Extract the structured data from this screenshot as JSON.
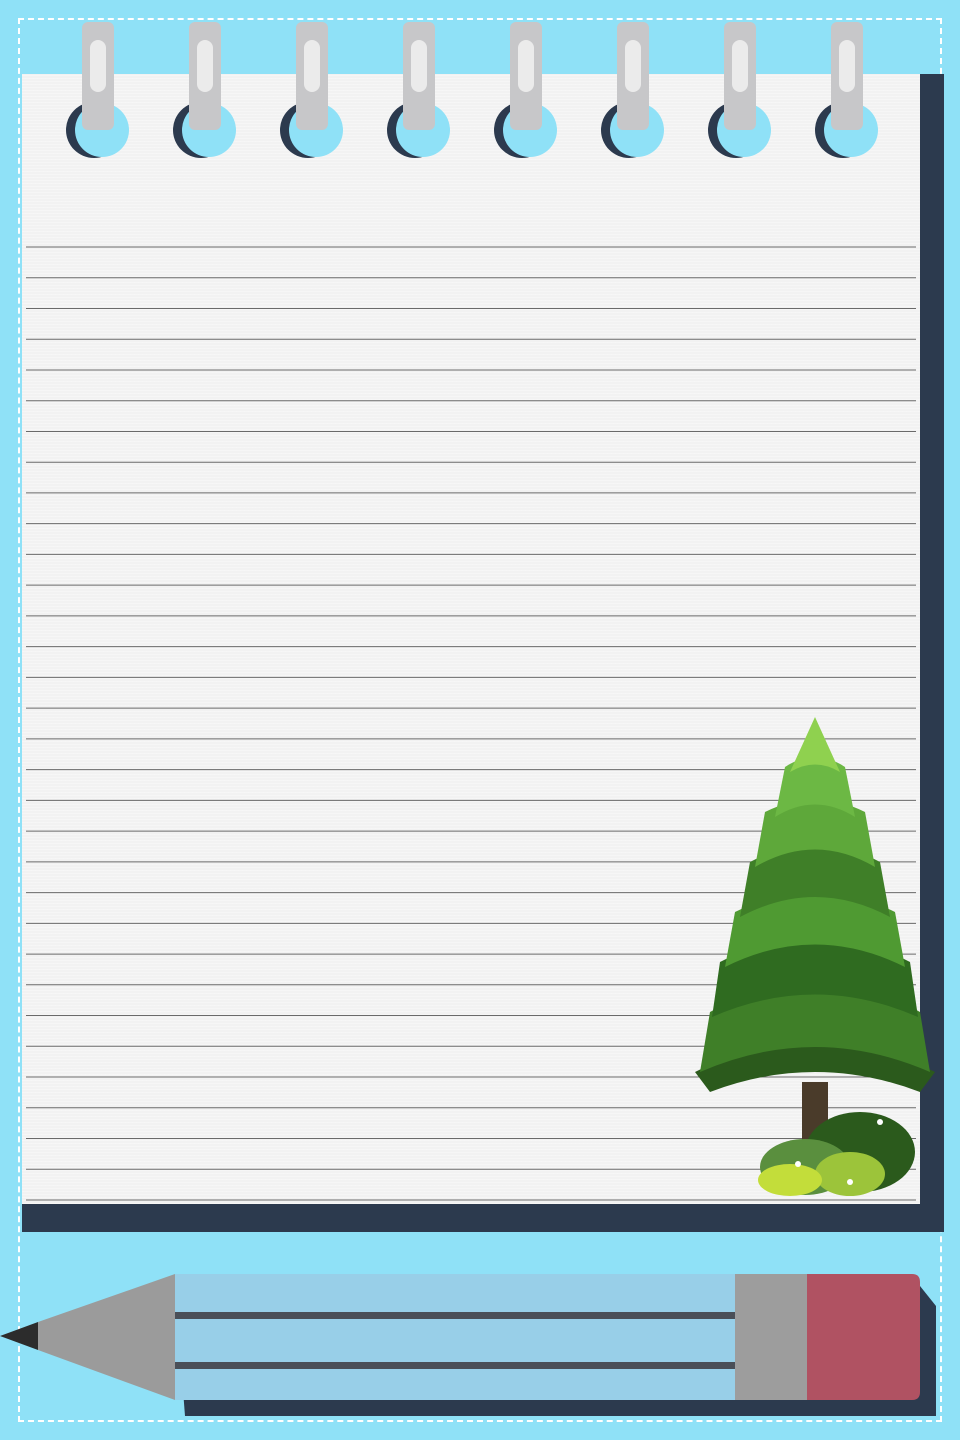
{
  "notebook": {
    "paper_color": "#f2f2f2",
    "cover_color": "#2c3a4e",
    "ring_count": 8,
    "ruled_line_count": 32
  },
  "background": {
    "color": "#8fe1f7",
    "border_style": "dashed white"
  },
  "pencil": {
    "body_color": "#98cfe8",
    "ferrule_color": "#9d9d9d",
    "eraser_color": "#b05262",
    "tip_color": "#9b9b9b"
  },
  "tree": {
    "foliage_colors": [
      "#8fd14f",
      "#5ea83a",
      "#3f7f28",
      "#2b5a1c"
    ],
    "trunk_color": "#4a3b2a"
  }
}
